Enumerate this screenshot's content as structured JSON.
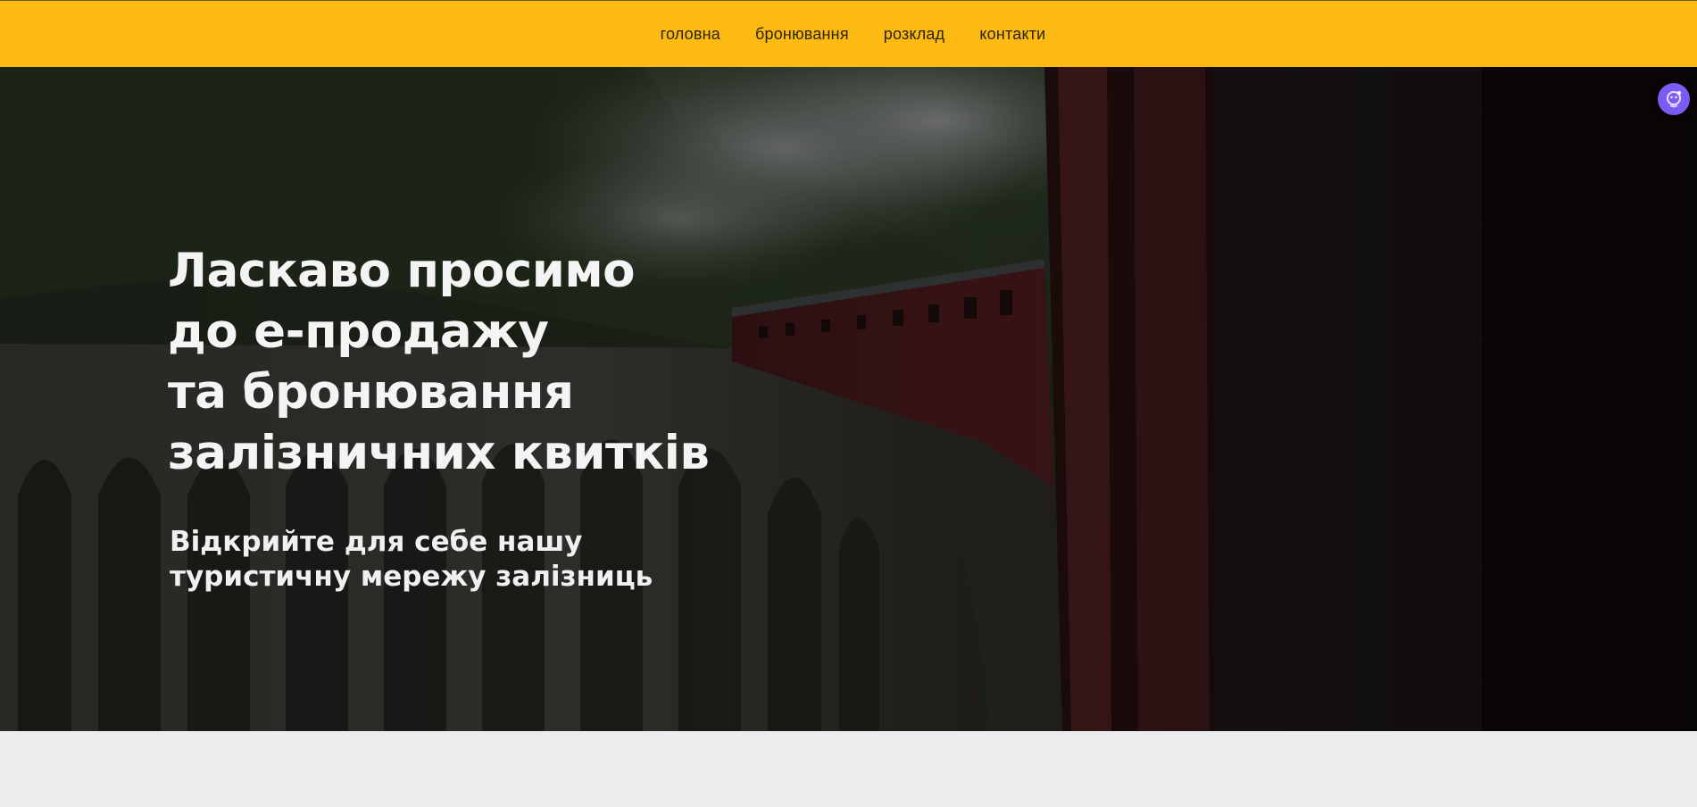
{
  "nav": {
    "items": [
      {
        "label": "головна"
      },
      {
        "label": "бронювання"
      },
      {
        "label": "розклад"
      },
      {
        "label": "контакти"
      }
    ]
  },
  "hero": {
    "title_lines": [
      "Ласкаво просимо",
      "до е-продажу",
      "та бронювання",
      "залізничних квитків"
    ],
    "subtitle_lines": [
      "Відкрийте для себе нашу",
      "туристичну мережу залізниць"
    ]
  },
  "colors": {
    "nav_bg": "#fdba12",
    "assistant": "#7a5cf5",
    "page_bg": "#ebecee"
  },
  "icons": {
    "assistant": "chat-assistant-icon"
  }
}
